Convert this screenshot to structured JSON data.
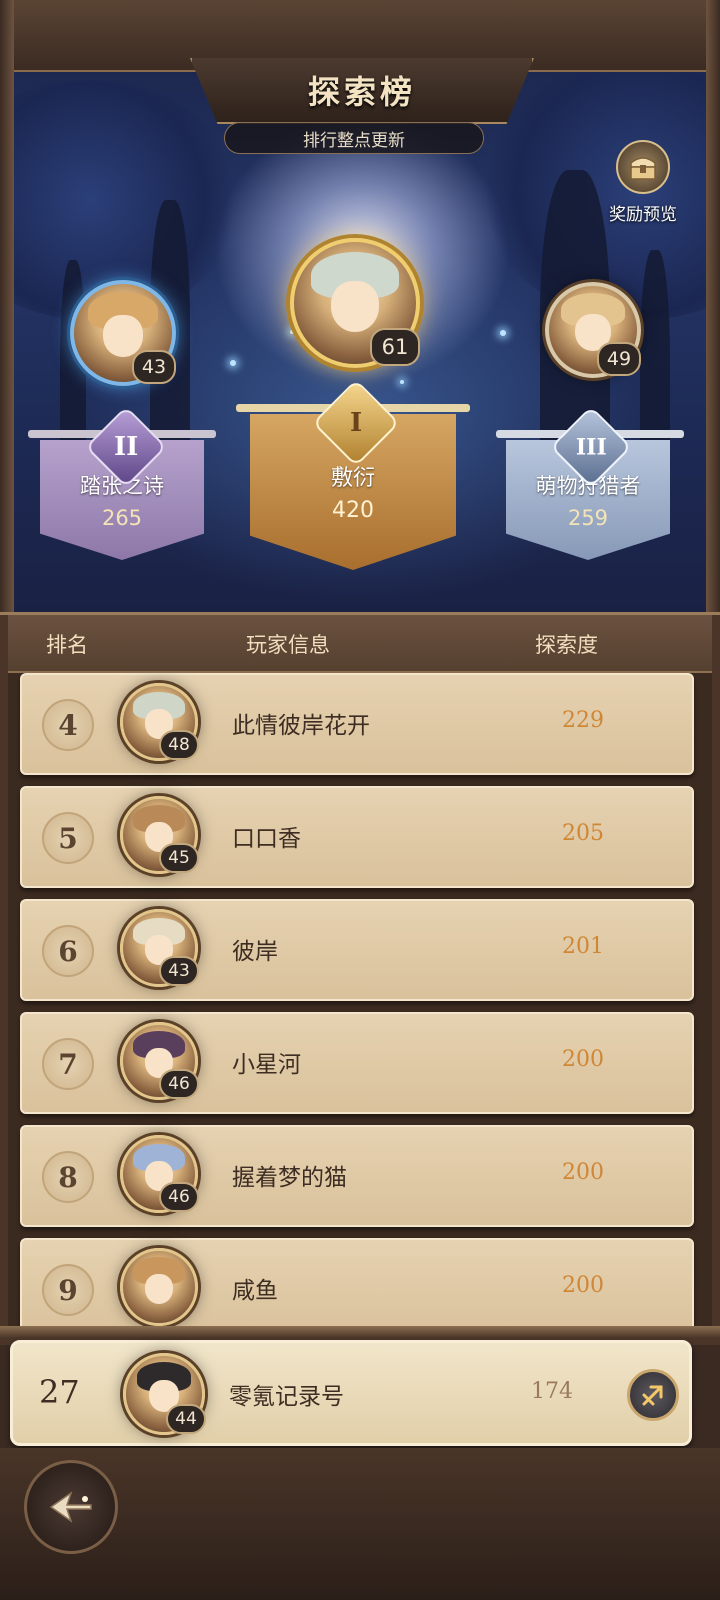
{
  "header": {
    "title": "探索榜",
    "subtitle": "排行整点更新",
    "reward_label": "奖励预览"
  },
  "podium": [
    {
      "place_icon": "II",
      "name": "踏张之诗",
      "score": "265",
      "level": "43"
    },
    {
      "place_icon": "I",
      "name": "敷衍",
      "score": "420",
      "level": "61"
    },
    {
      "place_icon": "III",
      "name": "萌物狩猎者",
      "score": "259",
      "level": "49"
    }
  ],
  "table": {
    "col_rank": "排名",
    "col_player": "玩家信息",
    "col_score": "探索度",
    "rows": [
      {
        "rank": "4",
        "name": "此情彼岸花开",
        "score": "229",
        "level": "48"
      },
      {
        "rank": "5",
        "name": "口口香",
        "score": "205",
        "level": "45"
      },
      {
        "rank": "6",
        "name": "彼岸",
        "score": "201",
        "level": "43"
      },
      {
        "rank": "7",
        "name": "小星河",
        "score": "200",
        "level": "46"
      },
      {
        "rank": "8",
        "name": "握着梦的猫",
        "score": "200",
        "level": "46"
      },
      {
        "rank": "9",
        "name": "咸鱼",
        "score": "200",
        "level": ""
      }
    ]
  },
  "me": {
    "rank": "27",
    "name": "零氪记录号",
    "score": "174",
    "level": "44"
  },
  "icons": {
    "reward": "treasure-chest-icon",
    "share": "share-icon",
    "back": "back-arrow-icon"
  },
  "colors": {
    "gold": "#d08735",
    "silver_plate": "#a28db8",
    "gold_plate": "#c08a45",
    "bronze_plate": "#a9b8d2"
  }
}
